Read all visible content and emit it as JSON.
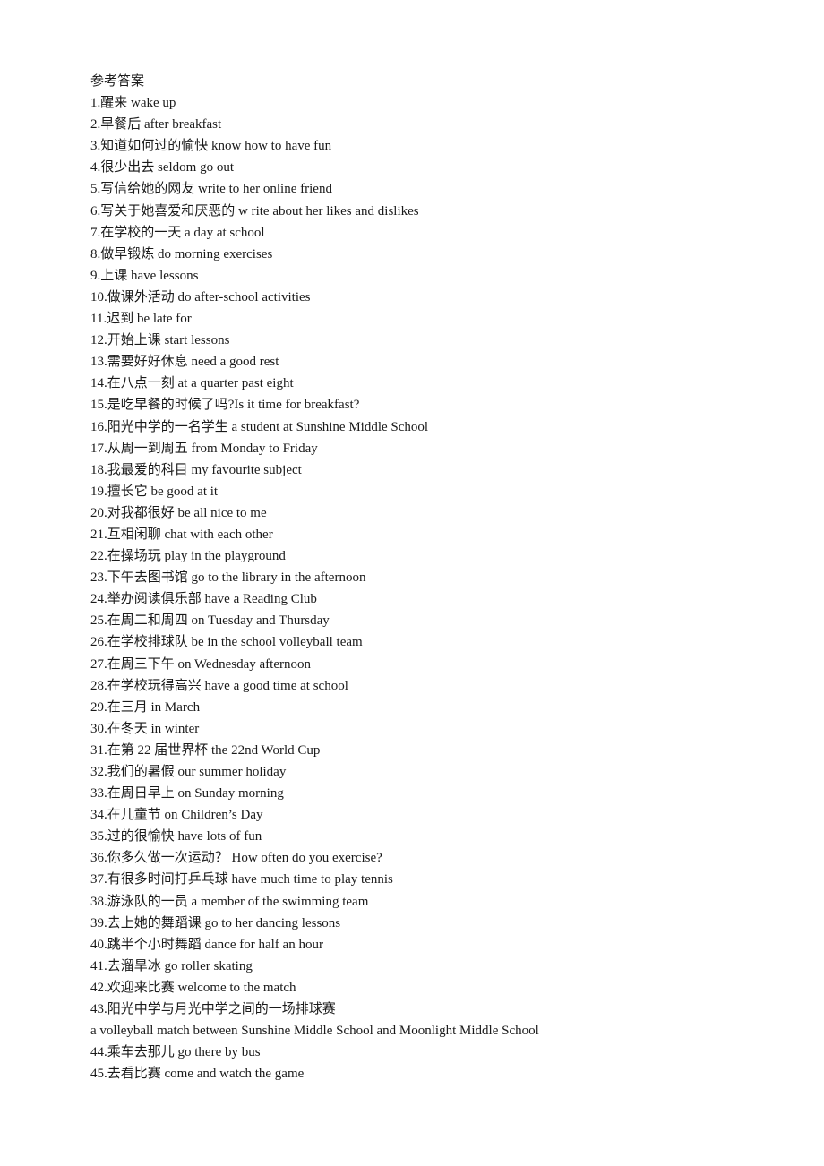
{
  "title": "参考答案",
  "lines": [
    "1.醒来 wake up",
    "2.早餐后 after breakfast",
    "3.知道如何过的愉快 know how to have fun",
    "4.很少出去 seldom go out",
    "5.写信给她的网友 write to her online friend",
    "6.写关于她喜爱和厌恶的 w rite about her likes and dislikes",
    "7.在学校的一天 a day at school",
    "8.做早锻炼 do morning exercises",
    "9.上课 have lessons",
    "10.做课外活动 do after-school activities",
    "11.迟到 be late for",
    "12.开始上课 start lessons",
    "13.需要好好休息 need a good rest",
    "14.在八点一刻 at a quarter past eight",
    "15.是吃早餐的时候了吗?Is it time for breakfast?",
    "16.阳光中学的一名学生 a student at Sunshine Middle School",
    "17.从周一到周五 from Monday to Friday",
    "18.我最爱的科目 my favourite subject",
    "19.擅长它 be good at it",
    "20.对我都很好 be all nice to me",
    "21.互相闲聊 chat with each other",
    "22.在操场玩 play in the playground",
    "23.下午去图书馆 go to the library in the afternoon",
    "24.举办阅读俱乐部 have a Reading Club",
    "25.在周二和周四 on Tuesday and Thursday",
    "26.在学校排球队 be in the school volleyball team",
    "27.在周三下午 on Wednesday afternoon",
    "28.在学校玩得高兴 have a good time at school",
    "29.在三月 in March",
    "30.在冬天 in winter",
    "31.在第 22 届世界杯 the 22nd World Cup",
    "32.我们的暑假 our summer holiday",
    "33.在周日早上 on Sunday morning",
    "34.在儿童节 on Children’s Day",
    "35.过的很愉快 have lots of fun",
    "36.你多久做一次运动？ How often do you exercise?",
    "37.有很多时间打乒乓球 have much time to play tennis",
    "38.游泳队的一员 a member of the swimming team",
    "39.去上她的舞蹈课 go to her dancing lessons",
    "40.跳半个小时舞蹈 dance for half an hour",
    "41.去溜旱冰 go roller skating",
    "42.欢迎来比赛 welcome to the match",
    "43.阳光中学与月光中学之间的一场排球赛",
    "a volleyball match between Sunshine Middle School and Moonlight Middle School",
    "44.乘车去那儿 go there by bus",
    "45.去看比赛 come and watch the game"
  ]
}
